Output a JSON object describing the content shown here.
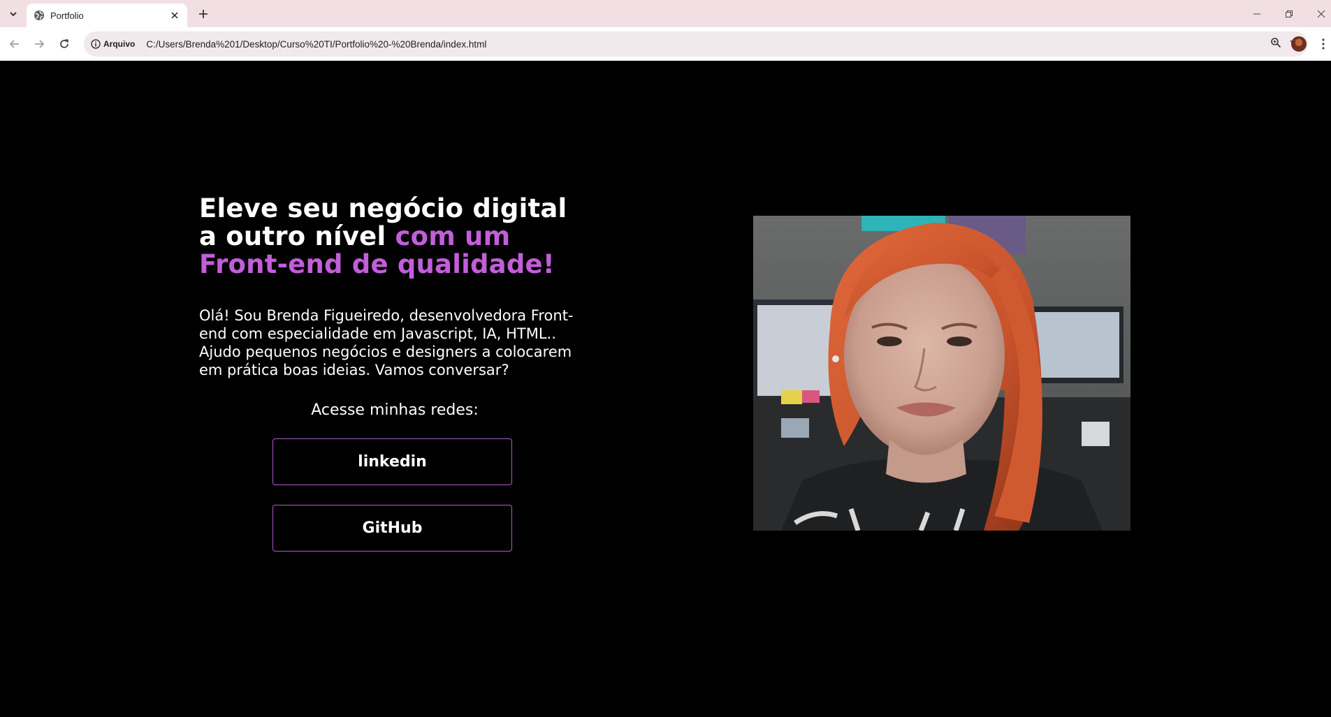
{
  "browser": {
    "tab": {
      "title": "Portfolio"
    },
    "address": {
      "security_label": "Arquivo",
      "url": "C:/Users/Brenda%201/Desktop/Curso%20TI/Portfolio%20-%20Brenda/index.html"
    }
  },
  "hero": {
    "headline_white": "Eleve seu negócio digital a outro nível ",
    "headline_accent": "com um Front-end de qualidade!",
    "intro": "Olá! Sou Brenda Figueiredo, desenvolvedora Front-end com especialidade em Javascript, IA, HTML.. Ajudo pequenos negócios e designers a colocarem em prática boas ideias. Vamos conversar?",
    "networks_label": "Acesse minhas redes:",
    "buttons": [
      {
        "label": "linkedin"
      },
      {
        "label": "GitHub"
      }
    ]
  },
  "colors": {
    "background": "#000000",
    "accent": "#c25ed9",
    "button_border": "#b05bc8",
    "tabbar": "#f2dfe4"
  }
}
